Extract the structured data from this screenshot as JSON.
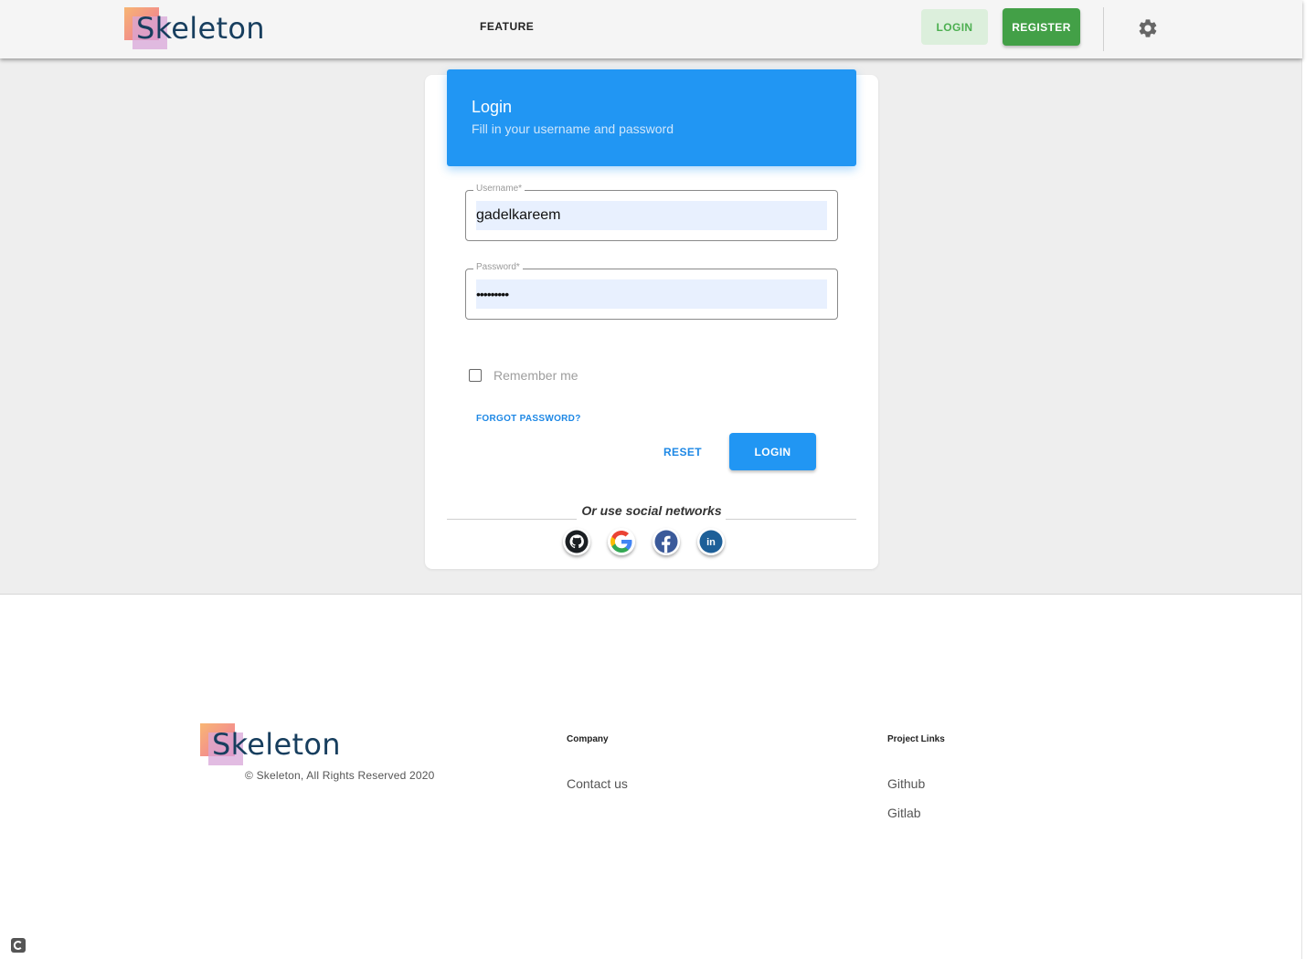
{
  "header": {
    "logo_text": "Skeleton",
    "nav": {
      "feature": "FEATURE"
    },
    "login_button": "LOGIN",
    "register_button": "REGISTER",
    "settings_icon": "gear-icon"
  },
  "login_card": {
    "title": "Login",
    "subtitle": "Fill in your username and password",
    "username": {
      "label": "Username*",
      "value": "gadelkareem"
    },
    "password": {
      "label": "Password*",
      "value": "•••••••••"
    },
    "remember_me": {
      "label": "Remember me",
      "checked": false
    },
    "forgot_password": "FORGOT PASSWORD?",
    "reset_button": "RESET",
    "login_button": "LOGIN",
    "social_text": "Or use social networks",
    "social_icons": [
      "github-icon",
      "google-icon",
      "facebook-icon",
      "linkedin-icon"
    ]
  },
  "footer": {
    "logo_text": "Skeleton",
    "copyright": "©  Skeleton, All Rights Reserved 2020",
    "company": {
      "heading": "Company",
      "links": [
        "Contact us"
      ]
    },
    "project_links": {
      "heading": "Project Links",
      "links": [
        "Github",
        "Gitlab"
      ]
    }
  },
  "colors": {
    "primary": "#2196f3",
    "register_green": "#43a047",
    "login_green_text": "#4caf50",
    "logo_text": "#173e5e"
  }
}
